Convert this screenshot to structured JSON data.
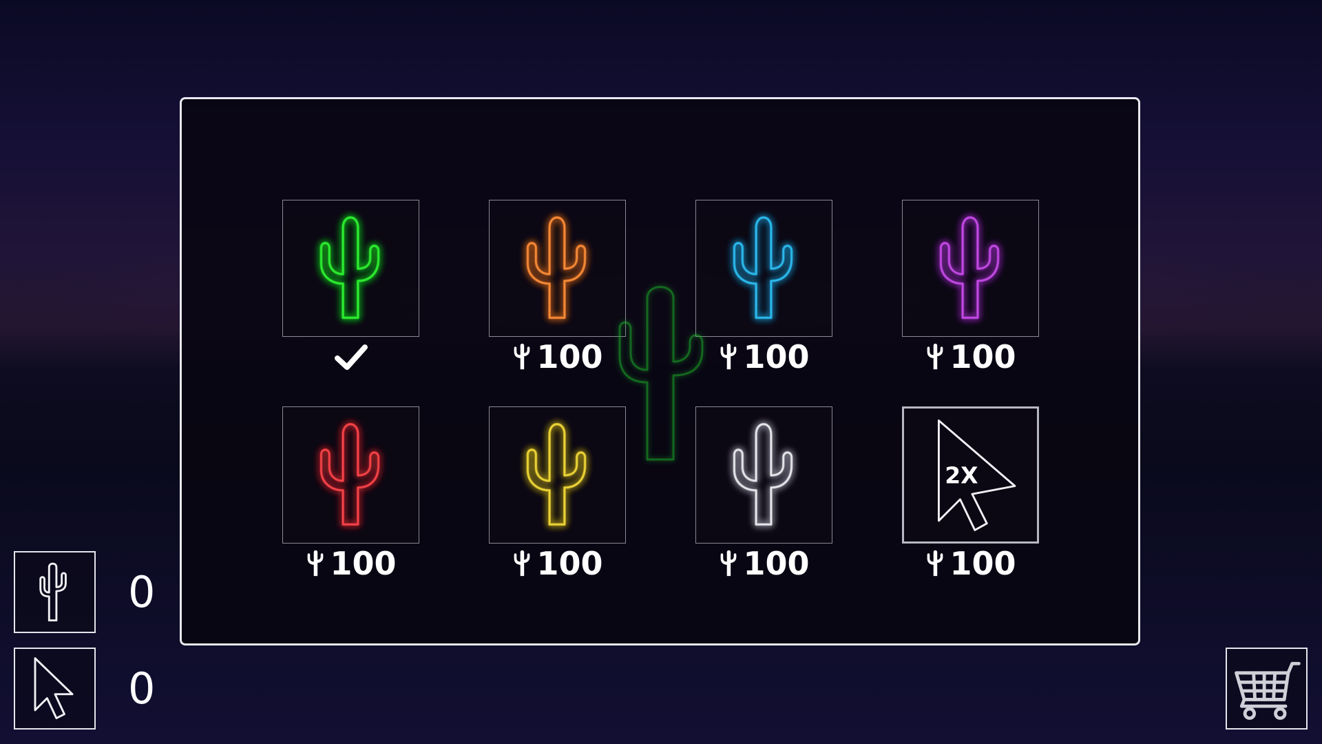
{
  "colors": {
    "panel_border": "#e8e8ee",
    "background": "#120f33"
  },
  "shop": {
    "items": [
      {
        "kind": "cactus-skin",
        "color": "#2ee833",
        "glow": "#19c21f",
        "status": "owned",
        "icon": "check-icon"
      },
      {
        "kind": "cactus-skin",
        "color": "#f08a3a",
        "glow": "#c35f1c",
        "price": "100"
      },
      {
        "kind": "cactus-skin",
        "color": "#2bb8e8",
        "glow": "#1e86b8",
        "price": "100"
      },
      {
        "kind": "cactus-skin",
        "color": "#c04ae0",
        "glow": "#8e2cb0",
        "price": "100"
      },
      {
        "kind": "cactus-skin",
        "color": "#f0444a",
        "glow": "#b8262c",
        "price": "100"
      },
      {
        "kind": "cactus-skin",
        "color": "#ead23a",
        "glow": "#b09c1a",
        "price": "100"
      },
      {
        "kind": "cactus-skin",
        "color": "#e6e6ea",
        "glow": "#9a9aa6",
        "price": "100"
      },
      {
        "kind": "powerup",
        "label": "2X",
        "icon": "cursor-icon",
        "price": "100"
      }
    ],
    "currency_icon": "cactus-coin-icon"
  },
  "counters": {
    "cactus": {
      "icon": "cactus-icon",
      "value": "0"
    },
    "clicks": {
      "icon": "cursor-icon",
      "value": "0"
    }
  },
  "cart": {
    "icon": "shopping-cart-icon"
  }
}
